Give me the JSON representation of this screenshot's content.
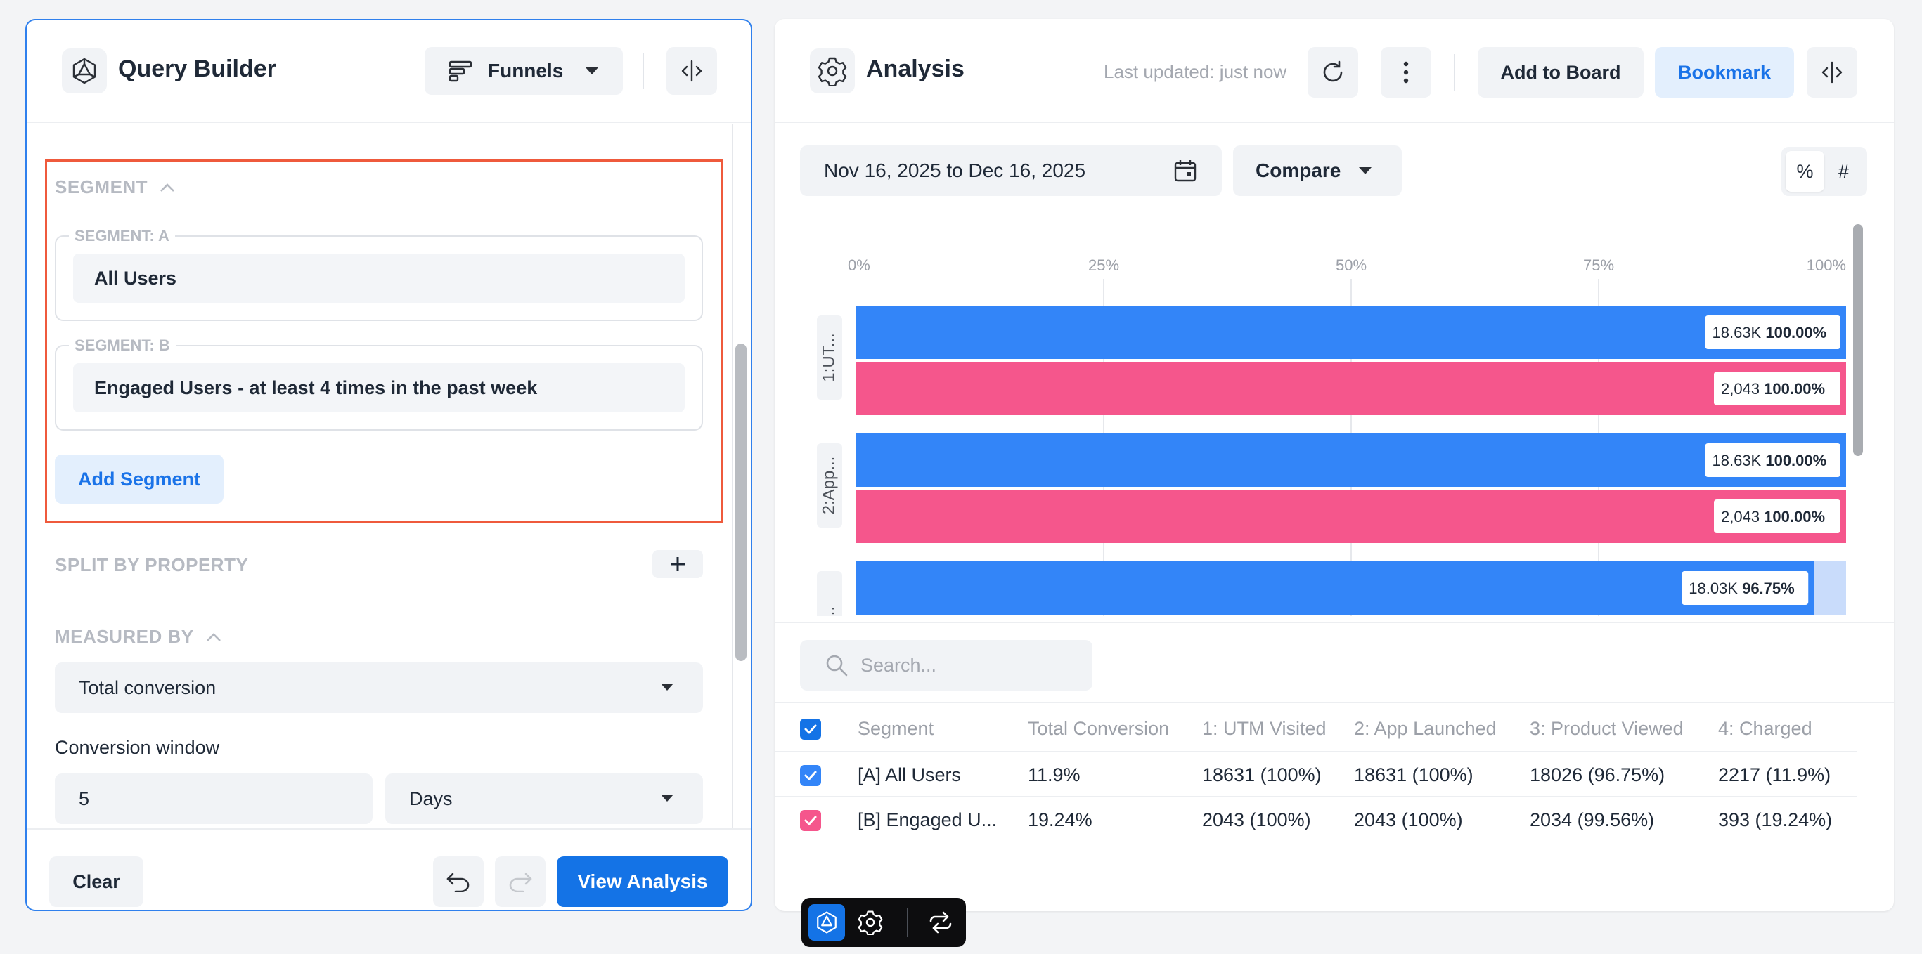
{
  "query_builder": {
    "title": "Query Builder",
    "report_type": "Funnels",
    "segment_section_label": "SEGMENT",
    "segments": [
      {
        "label": "SEGMENT: A",
        "value": "All Users"
      },
      {
        "label": "SEGMENT: B",
        "value": "Engaged Users - at least 4 times in the past week"
      }
    ],
    "add_segment_label": "Add Segment",
    "split_by_label": "SPLIT BY PROPERTY",
    "measured_by_label": "MEASURED BY",
    "measured_by_value": "Total conversion",
    "conversion_window_label": "Conversion window",
    "conversion_window_value": "5",
    "conversion_window_unit": "Days",
    "clear_label": "Clear",
    "view_analysis_label": "View Analysis"
  },
  "analysis": {
    "title": "Analysis",
    "last_updated": "Last updated: just now",
    "add_to_board_label": "Add to Board",
    "bookmark_label": "Bookmark",
    "date_range": "Nov 16, 2025 to Dec 16, 2025",
    "compare_label": "Compare",
    "toggle_percent": "%",
    "toggle_count": "#",
    "search_placeholder": "Search...",
    "table": {
      "headers": [
        "Segment",
        "Total Conversion",
        "1: UTM Visited",
        "2: App Launched",
        "3: Product Viewed",
        "4: Charged"
      ],
      "rows": [
        [
          "[A] All Users",
          "11.9%",
          "18631 (100%)",
          "18631 (100%)",
          "18026 (96.75%)",
          "2217 (11.9%)"
        ],
        [
          "[B] Engaged U...",
          "19.24%",
          "2043 (100%)",
          "2043 (100%)",
          "2034 (99.56%)",
          "393 (19.24%)"
        ]
      ]
    }
  },
  "colors": {
    "accent": "#1473e6",
    "segment_a": "#3385f8",
    "segment_b": "#f5568c",
    "highlight": "#ef5a3c"
  },
  "chart_data": {
    "type": "bar",
    "orientation": "horizontal",
    "xlim": [
      0,
      100
    ],
    "x_ticks": [
      "0%",
      "25%",
      "50%",
      "75%",
      "100%"
    ],
    "categories": [
      "1:UT...",
      "2:App...",
      "..."
    ],
    "series": [
      {
        "values": [
          100,
          100,
          96.75
        ],
        "counts": [
          "18.63K",
          "18.63K",
          "18.03K"
        ],
        "pct_labels": [
          "100.00%",
          "100.00%",
          "96.75%"
        ]
      },
      {
        "values": [
          100,
          100
        ],
        "counts": [
          "2,043",
          "2,043"
        ],
        "pct_labels": [
          "100.00%",
          "100.00%"
        ]
      }
    ]
  }
}
